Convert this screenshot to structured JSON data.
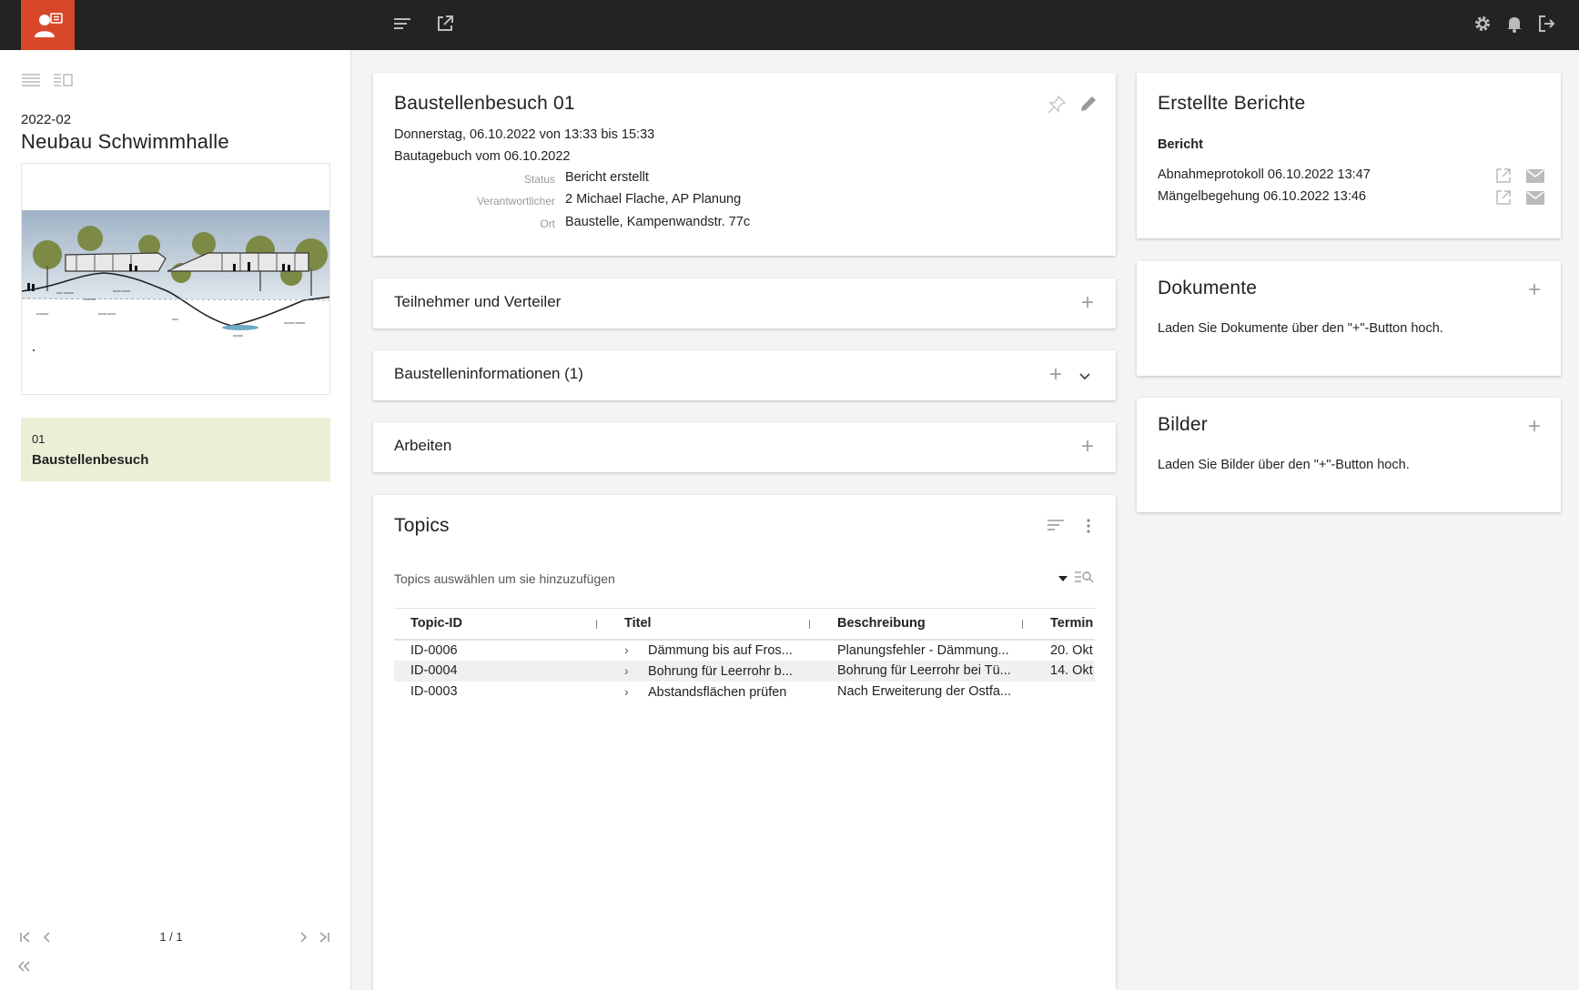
{
  "sidebar": {
    "project_code": "2022-02",
    "project_name": "Neubau Schwimmhalle",
    "visit": {
      "number": "01",
      "title": "Baustellenbesuch"
    },
    "pager": {
      "text": "1 / 1"
    }
  },
  "visit_card": {
    "title": "Baustellenbesuch 01",
    "date_line": "Donnerstag, 06.10.2022 von 13:33 bis 15:33",
    "diary_line": "Bautagebuch vom 06.10.2022",
    "fields": [
      {
        "label": "Status",
        "value": "Bericht erstellt"
      },
      {
        "label": "Verantwortlicher",
        "value": "2 Michael Flache, AP Planung"
      },
      {
        "label": "Ort",
        "value": "Baustelle, Kampenwandstr. 77c"
      }
    ]
  },
  "sections": {
    "participants": "Teilnehmer und Verteiler",
    "site_info": "Baustelleninformationen (1)",
    "works": "Arbeiten"
  },
  "topics": {
    "title": "Topics",
    "hint": "Topics auswählen um sie hinzuzufügen",
    "columns": [
      "Topic-ID",
      "Titel",
      "Beschreibung",
      "Termin"
    ],
    "rows": [
      {
        "id": "ID-0006",
        "title": "Dämmung bis auf Fros...",
        "description": "Planungsfehler - Dämmung...",
        "date": "20. Okt"
      },
      {
        "id": "ID-0004",
        "title": "Bohrung für Leerrohr b...",
        "description": "Bohrung für Leerrohr bei Tü...",
        "date": "14. Okt"
      },
      {
        "id": "ID-0003",
        "title": "Abstandsflächen prüfen",
        "description": "Nach Erweiterung der Ostfa...",
        "date": ""
      }
    ]
  },
  "reports": {
    "title": "Erstellte Berichte",
    "heading": "Bericht",
    "items": [
      "Abnahmeprotokoll 06.10.2022 13:47",
      "Mängelbegehung 06.10.2022 13:46"
    ]
  },
  "documents": {
    "title": "Dokumente",
    "hint": "Laden Sie Dokumente über den \"+\"-Button hoch."
  },
  "images": {
    "title": "Bilder",
    "hint": "Laden Sie Bilder über den \"+\"-Button hoch."
  },
  "colors": {
    "topbar": "#232323",
    "logo": "#d9472b",
    "visit_highlight": "#e9f0d6"
  },
  "icons": [
    "user-card-icon",
    "menu-icon",
    "open-external-icon",
    "gear-icon",
    "bell-icon",
    "logout-icon",
    "list-view-icon",
    "split-view-icon",
    "pin-icon",
    "pencil-icon",
    "plus-icon",
    "chevron-down-icon",
    "sort-icon",
    "more-vertical-icon",
    "filter-search-icon",
    "mail-icon"
  ]
}
